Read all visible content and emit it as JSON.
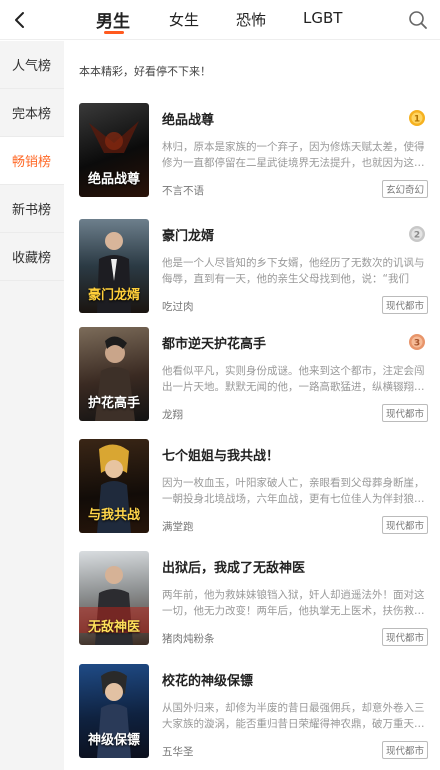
{
  "header": {
    "tabs": [
      {
        "label": "男生"
      },
      {
        "label": "女生"
      },
      {
        "label": "恐怖"
      },
      {
        "label": "LGBT"
      }
    ]
  },
  "sidebar": {
    "items": [
      {
        "label": "人气榜"
      },
      {
        "label": "完本榜"
      },
      {
        "label": "畅销榜"
      },
      {
        "label": "新书榜"
      },
      {
        "label": "收藏榜"
      }
    ]
  },
  "main": {
    "intro": "本本精彩，好看停不下来！",
    "books": [
      {
        "title": "绝品战尊",
        "desc": "林归，原本是家族的一个弃子，因为修炼天赋太差，使得修为一直都停留在二星武徒境界无法提升，也就因为这…",
        "author": "不言不语",
        "tag": "玄幻奇幻",
        "cover_text": "绝品战尊",
        "rank": 1
      },
      {
        "title": "豪门龙婿",
        "desc": "他是一个人尽皆知的乡下女婿，他经历了无数次的讥讽与侮辱，直到有一天，他的亲生父母找到他，说：“我们把…",
        "author": "吃过肉",
        "tag": "现代都市",
        "cover_text": "豪门龙婿",
        "rank": 2
      },
      {
        "title": "都市逆天护花高手",
        "desc": "他看似平凡，实则身份成谜。他来到这个都市，注定会闯出一片天地。默默无闻的他，一路高歌猛进，纵横辍翔…",
        "author": "龙翔",
        "tag": "现代都市",
        "cover_text": "护花高手",
        "rank": 3
      },
      {
        "title": "七个姐姐与我共战！",
        "desc": "因为一枚血玉，叶阳家破人亡，亲眼看到父母葬身断崖，一朝投身北境战场，六年血战，更有七位佳人为伴封狼…",
        "author": "满堂跑",
        "tag": "现代都市",
        "cover_text": "与我共战",
        "rank": null
      },
      {
        "title": "出狱后，我成了无敌神医",
        "desc": "两年前，他为救妹妹锒铛入狱，奸人却逍遥法外！面对这一切，他无力改变！两年后，他执掌无上医术，扶伤救…",
        "author": "猪肉炖粉条",
        "tag": "现代都市",
        "cover_text": "无敌神医",
        "rank": null
      },
      {
        "title": "校花的神级保镖",
        "desc": "从国外归来，却修为半废的昔日最强佣兵，却意外卷入三大家族的漩涡，能否重归昔日荣耀得神农鼎，破万重天…",
        "author": "五华圣",
        "tag": "现代都市",
        "cover_text": "神级保镖",
        "rank": null
      }
    ]
  },
  "colors": {
    "accent": "#ff5a1f",
    "sidebar_active_text": "#ff6a28",
    "sidebar_bg": "#f4f4f4",
    "rank1": "#f5b120",
    "rank2": "#c8c8c8",
    "rank3": "#e8956a"
  }
}
